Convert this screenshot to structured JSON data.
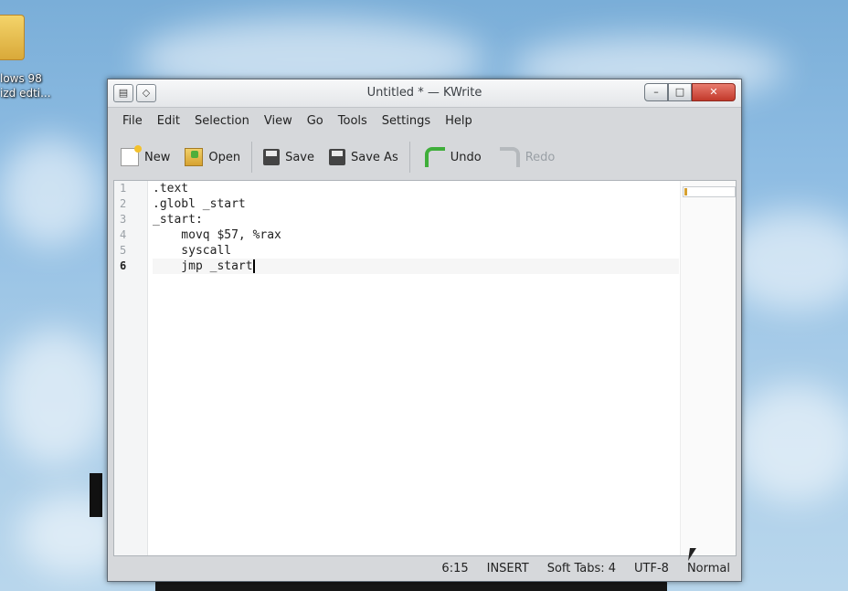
{
  "desktop": {
    "icon_label_line1": "lows 98",
    "icon_label_line2": "izd edti..."
  },
  "window": {
    "title": "Untitled * — KWrite",
    "menu": [
      "File",
      "Edit",
      "Selection",
      "View",
      "Go",
      "Tools",
      "Settings",
      "Help"
    ],
    "toolbar": {
      "new": "New",
      "open": "Open",
      "save": "Save",
      "save_as": "Save As",
      "undo": "Undo",
      "redo": "Redo"
    },
    "editor": {
      "line_numbers": [
        "1",
        "2",
        "3",
        "4",
        "5",
        "6"
      ],
      "lines": [
        ".text",
        ".globl _start",
        "_start:",
        "    movq $57, %rax",
        "    syscall",
        "    jmp _start"
      ],
      "current_line": 6
    },
    "status": {
      "position": "6:15",
      "mode": "INSERT",
      "tabs": "Soft Tabs: 4",
      "encoding": "UTF-8",
      "input_mode": "Normal"
    }
  },
  "colors": {
    "close_button": "#c2392b",
    "undo_accent": "#3fae3a"
  }
}
